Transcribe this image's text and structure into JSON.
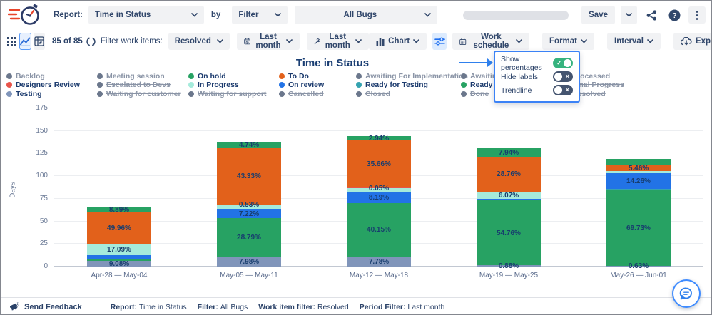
{
  "header": {
    "report_label": "Report:",
    "report_select": "Time in Status",
    "by_label": "by",
    "filter_select": "Filter",
    "scope_select": "All Bugs",
    "save_button": "Save"
  },
  "toolbar": {
    "count": "85 of 85",
    "filter_items_label": "Filter work items:",
    "status_select": "Resolved",
    "calendar_period": "Last month",
    "work_period": "Last month",
    "chart_button": "Chart",
    "work_schedule_button": "Work schedule",
    "format_button": "Format",
    "interval_button": "Interval",
    "export_button": "Export"
  },
  "settings_menu": {
    "items": [
      {
        "label": "Show percentages",
        "on": true
      },
      {
        "label": "Hide labels",
        "on": false
      },
      {
        "label": "Trendline",
        "on": false
      }
    ]
  },
  "colors": {
    "green": "#27a263",
    "orange": "#e2611b",
    "blue": "#2273e6",
    "cyan": "#a5ebdb",
    "teal": "#34a3b0",
    "slate": "#8095ba",
    "red": "#e8544a",
    "gray": "#6b778c",
    "accent_blue": "#2f80ed",
    "toggle_on": "#36b37e"
  },
  "legend": {
    "columns": [
      [
        {
          "label": "Backlog",
          "color": "gray",
          "struck": true
        },
        {
          "label": "Designers Review",
          "color": "red",
          "struck": false
        },
        {
          "label": "Testing",
          "color": "slate",
          "struck": false
        }
      ],
      [
        {
          "label": "Meeting session",
          "color": "gray",
          "struck": true
        },
        {
          "label": "Escalated to Devs",
          "color": "gray",
          "struck": true
        },
        {
          "label": "Waiting for customer",
          "color": "gray",
          "struck": true
        }
      ],
      [
        {
          "label": "On hold",
          "color": "green",
          "struck": false
        },
        {
          "label": "In Progress",
          "color": "cyan",
          "struck": false
        },
        {
          "label": "Waiting for support",
          "color": "gray",
          "struck": true
        }
      ],
      [
        {
          "label": "To Do",
          "color": "orange",
          "struck": false
        },
        {
          "label": "On review",
          "color": "blue",
          "struck": false
        },
        {
          "label": "Cancelled",
          "color": "gray",
          "struck": true
        }
      ],
      [
        {
          "label": "Awaiting For Implementation",
          "color": "gray",
          "struck": true
        },
        {
          "label": "Ready for Testing",
          "color": "teal",
          "struck": false
        },
        {
          "label": "Closed",
          "color": "gray",
          "struck": true
        }
      ],
      [
        {
          "label": "Awaiting",
          "color": "gray",
          "struck": true
        },
        {
          "label": "Ready to r",
          "color": "green",
          "struck": false
        },
        {
          "label": "Done",
          "color": "gray",
          "struck": true
        }
      ],
      [
        {
          "label": "Processed",
          "color": "gray",
          "struck": true
        },
        {
          "label": "Final Progress",
          "color": "gray",
          "struck": true
        },
        {
          "label": "Resolved",
          "color": "gray",
          "struck": true
        }
      ]
    ]
  },
  "chart_data": {
    "type": "stacked-bar",
    "title": "Time in Status",
    "ylabel": "Days",
    "ylim": [
      0,
      175
    ],
    "yticks": [
      0,
      25,
      50,
      75,
      100,
      125,
      150,
      175
    ],
    "categories": [
      "Apr-28 — May-04",
      "May-05 — May-11",
      "May-12 — May-18",
      "May-19 — May-25",
      "May-26 — Jun-01"
    ],
    "bars": [
      {
        "category": "Apr-28 — May-04",
        "segments": [
          {
            "status": "Testing",
            "color": "slate",
            "days": 6.4,
            "label": "9.08%"
          },
          {
            "status": "Ready to r",
            "color": "green",
            "days": 1.6,
            "label": null
          },
          {
            "status": "On review",
            "color": "blue",
            "days": 5.0,
            "label": null
          },
          {
            "status": "In Progress",
            "color": "cyan",
            "days": 12.0,
            "label": "17.09%"
          },
          {
            "status": "To Do",
            "color": "orange",
            "days": 35.0,
            "label": "49.96%"
          },
          {
            "status": "On hold",
            "color": "green",
            "days": 6.2,
            "label": "8.89%"
          }
        ]
      },
      {
        "category": "May-05 — May-11",
        "segments": [
          {
            "status": "Testing",
            "color": "slate",
            "days": 11.3,
            "label": "7.98%"
          },
          {
            "status": "Ready to r",
            "color": "green",
            "days": 42.0,
            "label": "28.79%"
          },
          {
            "status": "On review",
            "color": "blue",
            "days": 10.2,
            "label": "7.22%"
          },
          {
            "status": "In Progress",
            "color": "cyan",
            "days": 4.6,
            "label": null
          },
          {
            "status": "Designers Review",
            "color": "red",
            "days": 0.8,
            "label": "0.53%"
          },
          {
            "status": "To Do",
            "color": "orange",
            "days": 62.5,
            "label": "43.33%"
          },
          {
            "status": "On hold",
            "color": "green",
            "days": 6.7,
            "label": "4.74%"
          }
        ]
      },
      {
        "category": "May-12 — May-18",
        "segments": [
          {
            "status": "Testing",
            "color": "slate",
            "days": 11.4,
            "label": "7.78%"
          },
          {
            "status": "Ready to r",
            "color": "green",
            "days": 59.0,
            "label": "40.15%"
          },
          {
            "status": "On review",
            "color": "blue",
            "days": 12.0,
            "label": "8.19%"
          },
          {
            "status": "In Progress",
            "color": "cyan",
            "days": 4.5,
            "label": null
          },
          {
            "status": "Designers Review",
            "color": "red",
            "days": 0.3,
            "label": "0.05%"
          },
          {
            "status": "To Do",
            "color": "orange",
            "days": 52.5,
            "label": "35.66%"
          },
          {
            "status": "On hold",
            "color": "green",
            "days": 4.3,
            "label": "2.94%"
          }
        ]
      },
      {
        "category": "May-19 — May-25",
        "segments": [
          {
            "status": "Testing",
            "color": "slate",
            "days": 1.2,
            "label": "0.88%"
          },
          {
            "status": "Ready to r",
            "color": "green",
            "days": 72.5,
            "label": "54.76%"
          },
          {
            "status": "On review",
            "color": "blue",
            "days": 1.4,
            "label": null
          },
          {
            "status": "In Progress",
            "color": "cyan",
            "days": 8.0,
            "label": "6.07%"
          },
          {
            "status": "To Do",
            "color": "orange",
            "days": 38.0,
            "label": "28.76%"
          },
          {
            "status": "On hold",
            "color": "green",
            "days": 10.5,
            "label": "7.94%"
          }
        ]
      },
      {
        "category": "May-26 — Jun-01",
        "segments": [
          {
            "status": "Testing",
            "color": "slate",
            "days": 0.9,
            "label": "0.63%"
          },
          {
            "status": "Ready to r",
            "color": "green",
            "days": 83.5,
            "label": "69.73%"
          },
          {
            "status": "Ready for Testing",
            "color": "teal",
            "days": 1.8,
            "label": null
          },
          {
            "status": "On review",
            "color": "blue",
            "days": 17.0,
            "label": "14.26%"
          },
          {
            "status": "In Progress",
            "color": "cyan",
            "days": 2.7,
            "label": null
          },
          {
            "status": "To Do",
            "color": "orange",
            "days": 6.5,
            "label": "5.46%"
          },
          {
            "status": "On hold",
            "color": "green",
            "days": 6.6,
            "label": null
          }
        ]
      }
    ]
  },
  "footer": {
    "feedback": "Send Feedback",
    "meta": [
      {
        "label": "Report:",
        "value": "Time in Status"
      },
      {
        "label": "Filter:",
        "value": "All Bugs"
      },
      {
        "label": "Work item filter:",
        "value": "Resolved"
      },
      {
        "label": "Period Filter:",
        "value": "Last month"
      }
    ]
  }
}
